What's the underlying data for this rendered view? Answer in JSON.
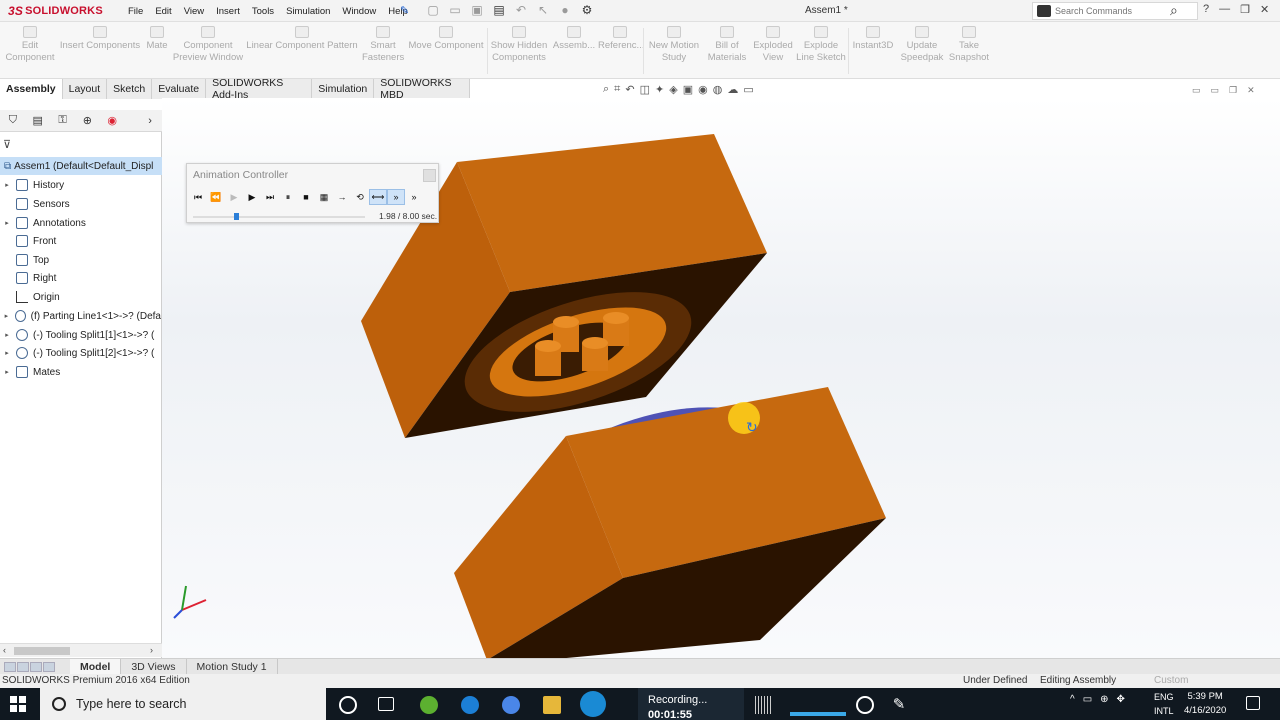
{
  "app": {
    "name": "SOLIDWORKS",
    "doc_title": "Assem1 *"
  },
  "menus": [
    "File",
    "Edit",
    "View",
    "Insert",
    "Tools",
    "Simulation",
    "Window",
    "Help"
  ],
  "search": {
    "placeholder": "Search Commands"
  },
  "ribbon": [
    {
      "label": "Edit Component"
    },
    {
      "label": "Insert Components"
    },
    {
      "label": "Mate"
    },
    {
      "label": "Component Preview Window"
    },
    {
      "label": "Linear Component Pattern"
    },
    {
      "label": "Smart Fasteners"
    },
    {
      "label": "Move Component"
    },
    {
      "label": "Show Hidden Components"
    },
    {
      "label": "Assemb..."
    },
    {
      "label": "Referenc..."
    },
    {
      "label": "New Motion Study"
    },
    {
      "label": "Bill of Materials"
    },
    {
      "label": "Exploded View"
    },
    {
      "label": "Explode Line Sketch"
    },
    {
      "label": "Instant3D"
    },
    {
      "label": "Update Speedpak"
    },
    {
      "label": "Take Snapshot"
    }
  ],
  "tabs": [
    "Assembly",
    "Layout",
    "Sketch",
    "Evaluate",
    "SOLIDWORKS Add-Ins",
    "Simulation",
    "SOLIDWORKS MBD"
  ],
  "tree": {
    "root": "Assem1  (Default<Default_Displ",
    "items": [
      {
        "label": "History",
        "expand": "▸",
        "icon": "history-icon"
      },
      {
        "label": "Sensors",
        "expand": "",
        "icon": "sensors-icon"
      },
      {
        "label": "Annotations",
        "expand": "▸",
        "icon": "annotations-icon"
      },
      {
        "label": "Front",
        "expand": "",
        "icon": "plane-icon"
      },
      {
        "label": "Top",
        "expand": "",
        "icon": "plane-icon"
      },
      {
        "label": "Right",
        "expand": "",
        "icon": "plane-icon"
      },
      {
        "label": "Origin",
        "expand": "",
        "icon": "origin-icon"
      },
      {
        "label": "(f) Parting Line1<1>->? (Defa",
        "expand": "▸",
        "icon": "part-icon"
      },
      {
        "label": "(-) Tooling Split1[1]<1>->? (",
        "expand": "▸",
        "icon": "part-icon"
      },
      {
        "label": "(-) Tooling Split1[2]<1>->? (",
        "expand": "▸",
        "icon": "part-icon"
      },
      {
        "label": "Mates",
        "expand": "▸",
        "icon": "mates-icon"
      }
    ]
  },
  "animation": {
    "title": "Animation Controller",
    "time": "1.98 / 8.00 sec.",
    "progress": 0.2475
  },
  "bottom_tabs": [
    "Model",
    "3D Views",
    "Motion Study 1"
  ],
  "status": {
    "edition": "SOLIDWORKS Premium 2016 x64 Edition",
    "definition": "Under Defined",
    "mode": "Editing Assembly",
    "units": "Custom"
  },
  "taskbar": {
    "search_placeholder": "Type here to search",
    "recording": "Recording...",
    "recording_time": "00:01:55",
    "lang1": "ENG",
    "lang2": "INTL",
    "time": "5:39 PM",
    "date": "4/16/2020"
  },
  "colors": {
    "mold": "#c6690f",
    "mold_dark": "#2a1300",
    "accent": "#c8102e",
    "selection": "#c6dff7"
  }
}
